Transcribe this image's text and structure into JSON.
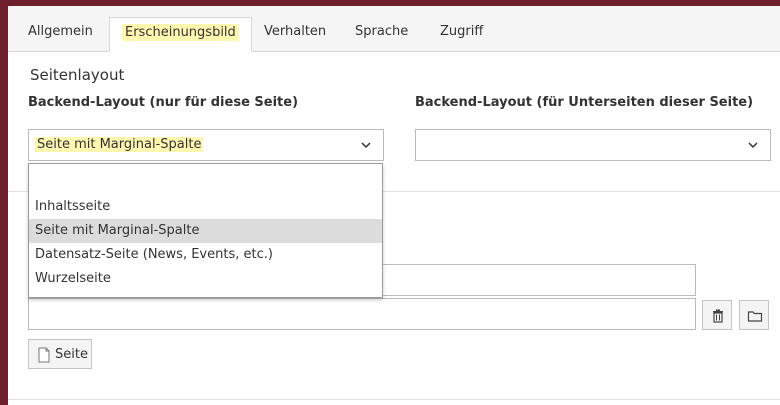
{
  "tabs": [
    {
      "label": "Allgemein",
      "active": false
    },
    {
      "label": "Erscheinungsbild",
      "active": true
    },
    {
      "label": "Verhalten",
      "active": false
    },
    {
      "label": "Sprache",
      "active": false
    },
    {
      "label": "Zugriff",
      "active": false
    }
  ],
  "section": {
    "title": "Seitenlayout"
  },
  "backend_layout": {
    "label": "Backend-Layout (nur für diese Seite)",
    "selected": "Seite mit Marginal-Spalte",
    "options": [
      "",
      "Inhaltsseite",
      "Seite mit Marginal-Spalte",
      "Datensatz-Seite (News, Events, etc.)",
      "Wurzelseite"
    ],
    "selected_index": 2
  },
  "backend_layout_sub": {
    "label": "Backend-Layout (für Unterseiten dieser Seite)",
    "selected": ""
  },
  "page_button": {
    "label": "Seite"
  },
  "icons": [
    "chevron-down-icon",
    "trash-icon",
    "folder-icon",
    "page-icon"
  ],
  "colors": {
    "frame": "#6e1f2c",
    "highlight": "#fff7b0",
    "selected_option": "#dcdcdc"
  }
}
